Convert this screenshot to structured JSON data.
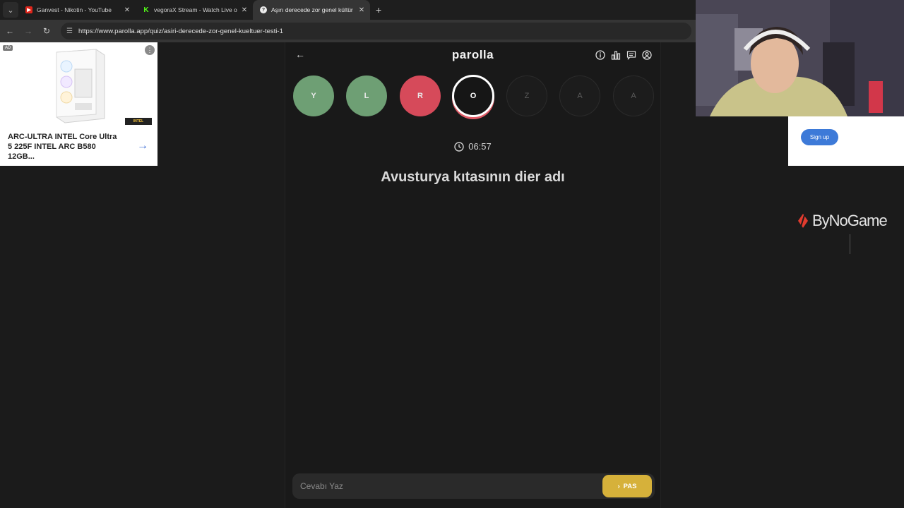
{
  "browser": {
    "tabs": [
      {
        "title": "Ganvest - Nikotin - YouTube",
        "icon": "youtube-icon",
        "active": false
      },
      {
        "title": "vegoraX Stream - Watch Live o",
        "icon": "kick-icon",
        "active": false
      },
      {
        "title": "Aşırı derecede zor genel kültür",
        "icon": "parolla-icon",
        "active": true
      }
    ],
    "url": "https://www.parolla.app/quiz/asiri-derecede-zor-genel-kueltuer-testi-1"
  },
  "game": {
    "brand": "parolla",
    "letters": [
      {
        "char": "Y",
        "state": "correct"
      },
      {
        "char": "L",
        "state": "correct"
      },
      {
        "char": "R",
        "state": "wrong"
      },
      {
        "char": "O",
        "state": "current"
      },
      {
        "char": "Z",
        "state": "pending"
      },
      {
        "char": "A",
        "state": "pending"
      },
      {
        "char": "A",
        "state": "pending"
      }
    ],
    "timer": "06:57",
    "question": "Avusturya kıtasının dier adı",
    "answer_placeholder": "Cevabı Yaz",
    "pass_label": "PAS"
  },
  "ad": {
    "badge": "AD",
    "text": "ARC-ULTRA INTEL Core Ultra 5 225F INTEL ARC B580 12GB..."
  },
  "right": {
    "signup_label": "Sign up",
    "sponsor": "ByNoGame"
  },
  "colors": {
    "correct": "#6e9f74",
    "wrong": "#d64a5a",
    "pass": "#d6b13a",
    "accent_ring": "#e05b67"
  }
}
